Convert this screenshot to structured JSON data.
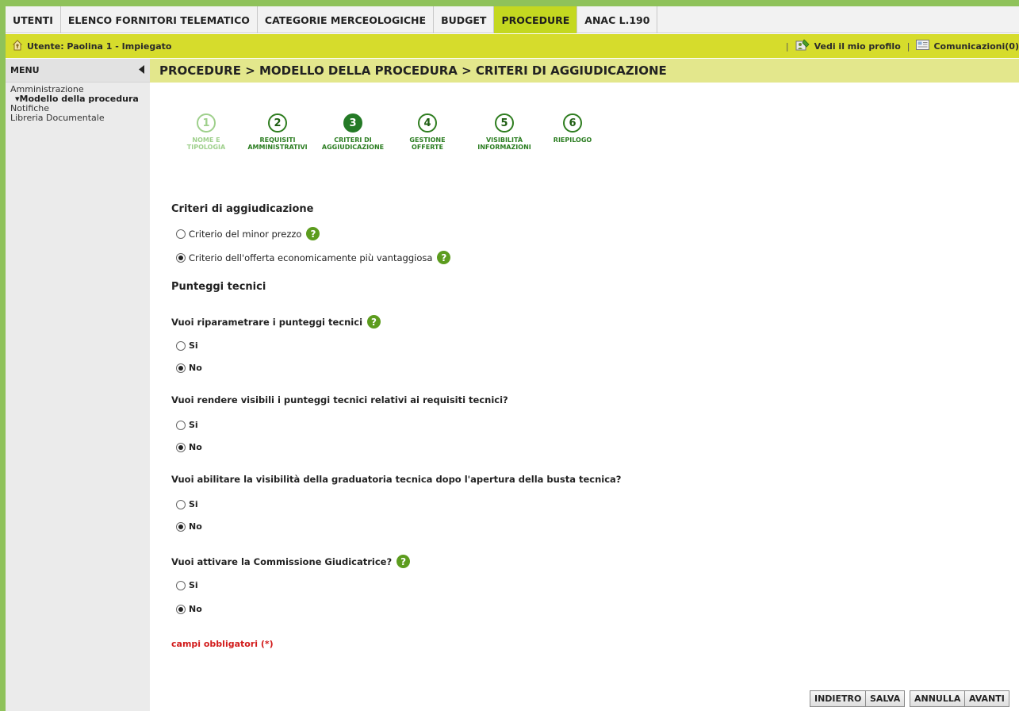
{
  "topnav": {
    "tabs": [
      {
        "label": "UTENTI"
      },
      {
        "label": "ELENCO FORNITORI TELEMATICO"
      },
      {
        "label": "CATEGORIE MERCEOLOGICHE"
      },
      {
        "label": "BUDGET"
      },
      {
        "label": "PROCEDURE"
      },
      {
        "label": "ANAC L.190"
      }
    ],
    "active": "PROCEDURE"
  },
  "userbar": {
    "user_label": "Utente: Paolina 1 - Impiegato",
    "profile_link": "Vedi il mio profilo",
    "messages_link": "Comunicazioni(0)",
    "separator": "|"
  },
  "sidebar": {
    "header": "MENU",
    "items": [
      {
        "label": "Amministrazione"
      },
      {
        "label": "▾Modello della procedura"
      },
      {
        "label": "Notifiche"
      },
      {
        "label": "Libreria Documentale"
      }
    ]
  },
  "breadcrumb": "PROCEDURE  > MODELLO DELLA PROCEDURA  > CRITERI DI AGGIUDICAZIONE",
  "wizard": {
    "steps": [
      {
        "number": "1",
        "label": "NOME E TIPOLOGIA",
        "state": "done"
      },
      {
        "number": "2",
        "label": "REQUISITI AMMINISTRATIVI",
        "state": "todo"
      },
      {
        "number": "3",
        "label": "CRITERI DI AGGIUDICAZIONE",
        "state": "current"
      },
      {
        "number": "4",
        "label": "GESTIONE OFFERTE",
        "state": "todo"
      },
      {
        "number": "5",
        "label": "VISIBILITÀ INFORMAZIONI",
        "state": "todo"
      },
      {
        "number": "6",
        "label": "RIEPILOGO",
        "state": "todo"
      }
    ]
  },
  "form": {
    "criteria_title": "Criteri di aggiudicazione",
    "criteria_options": [
      {
        "label": "Criterio del minor prezzo",
        "selected": false
      },
      {
        "label": "Criterio dell'offerta economicamente più vantaggiosa",
        "selected": true
      }
    ],
    "scores_title": "Punteggi tecnici",
    "questions": [
      {
        "label": "Vuoi riparametrare i punteggi tecnici",
        "help": true,
        "yes": "Si",
        "no": "No",
        "value": "No"
      },
      {
        "label": "Vuoi rendere visibili i punteggi tecnici relativi ai requisiti tecnici?",
        "help": false,
        "yes": "Si",
        "no": "No",
        "value": "No"
      },
      {
        "label": "Vuoi abilitare la visibilità della graduatoria tecnica dopo l'apertura della busta tecnica?",
        "help": false,
        "yes": "Si",
        "no": "No",
        "value": "No"
      },
      {
        "label": "Vuoi attivare la Commissione Giudicatrice?",
        "help": true,
        "yes": "Si",
        "no": "No",
        "value": "No"
      }
    ],
    "required_note": "campi obbligatori (*)",
    "help_icon_glyph": "?"
  },
  "buttons": {
    "back": "INDIETRO",
    "save": "SALVA",
    "cancel": "ANNULLA",
    "next": "AVANTI"
  },
  "colors": {
    "frame_green": "#8fc25a",
    "active_tab": "#c4d820",
    "userbar": "#d6dc2c",
    "breadcrumb_bg": "#e3e78c",
    "step_green": "#247a26",
    "help_green": "#5c9c1e",
    "required_red": "#d21b1b"
  }
}
